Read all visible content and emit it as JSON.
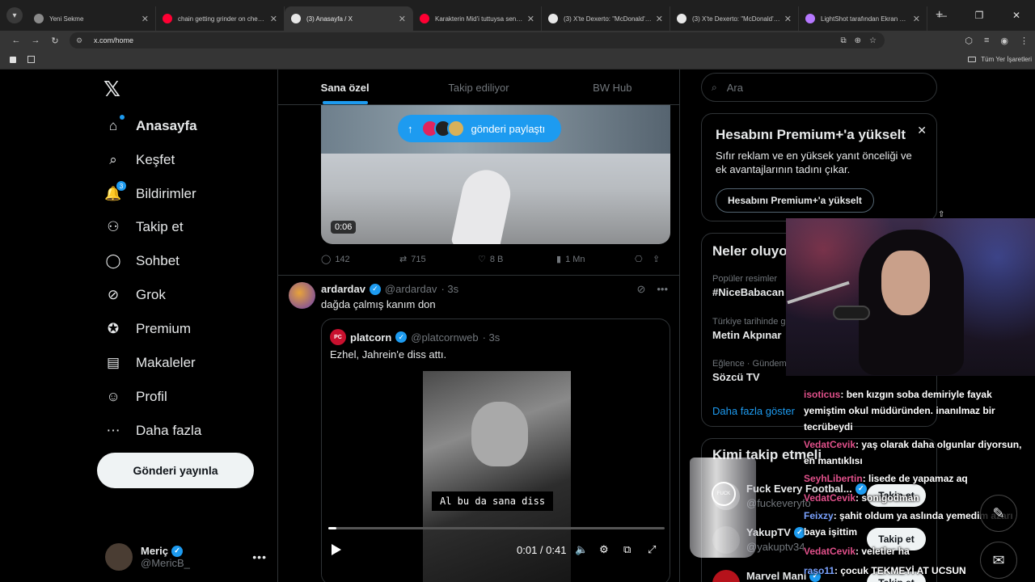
{
  "browser": {
    "tabs": [
      {
        "title": "Yeni Sekme",
        "favicon": "chrome-icon",
        "favicon_color": "#8a8a8a",
        "active": false
      },
      {
        "title": "chain getting grinder on cheese...",
        "favicon": "youtube-icon",
        "favicon_color": "#ff0033",
        "active": false
      },
      {
        "title": "(3) Anasayfa / X",
        "favicon": "x-icon",
        "favicon_color": "#e8e8e8",
        "active": true
      },
      {
        "title": "Karakterin Mid'i tuttuysa sen de...",
        "favicon": "youtube-icon",
        "favicon_color": "#ff0033",
        "active": false
      },
      {
        "title": "(3) X'te Dexerto: \"McDonald's h...",
        "favicon": "x-icon",
        "favicon_color": "#e8e8e8",
        "active": false
      },
      {
        "title": "(3) X'te Dexerto: \"McDonald's h...",
        "favicon": "x-icon",
        "favicon_color": "#e8e8e8",
        "active": false
      },
      {
        "title": "LightShot tarafından Ekran Görü...",
        "favicon": "feather-icon",
        "favicon_color": "#b678ff",
        "active": false
      }
    ],
    "url": "x.com/home",
    "bookmarks_all": "Tüm Yer İşaretleri"
  },
  "nav": {
    "items": [
      {
        "label": "Anasayfa",
        "icon": "home-icon",
        "bold": true
      },
      {
        "label": "Keşfet",
        "icon": "search-icon"
      },
      {
        "label": "Bildirimler",
        "icon": "bell-icon",
        "badge": "3"
      },
      {
        "label": "Takip et",
        "icon": "add-user-icon"
      },
      {
        "label": "Sohbet",
        "icon": "chat-icon"
      },
      {
        "label": "Grok",
        "icon": "grok-icon"
      },
      {
        "label": "Premium",
        "icon": "premium-icon"
      },
      {
        "label": "Makaleler",
        "icon": "articles-icon"
      },
      {
        "label": "Profil",
        "icon": "profile-icon"
      },
      {
        "label": "Daha fazla",
        "icon": "more-icon"
      }
    ],
    "post_button": "Gönderi yayınla",
    "account": {
      "name": "Meriç",
      "handle": "@MericB_"
    }
  },
  "timeline": {
    "tabs": [
      "Sana özel",
      "Takip ediliyor",
      "BW Hub"
    ],
    "share_pill": "gönderi paylaştı",
    "tweet1": {
      "video_time": "0:06",
      "replies": "142",
      "retweets": "715",
      "likes": "8 B",
      "views": "1 Mn"
    },
    "tweet2": {
      "name": "ardardav",
      "handle": "@ardardav",
      "time": "· 3s",
      "text": "dağda çalmış kanım don",
      "quote": {
        "avatar_label": "PC",
        "name": "platcorn",
        "handle": "@platcornweb",
        "time": "· 3s",
        "text": "Ezhel, Jahrein'e diss attı.",
        "subtitle": "Al bu da sana diss",
        "duration": "0:01 / 0:41",
        "progress": 0.024
      }
    }
  },
  "sidebar": {
    "search_placeholder": "Ara",
    "premium": {
      "title": "Hesabını Premium+'a yükselt",
      "text": "Sıfır reklam ve en yüksek yanıt önceliği ve ek avantajlarının tadını çıkar.",
      "button": "Hesabını Premium+'a yükselt"
    },
    "trends": {
      "title": "Neler oluyo",
      "items": [
        {
          "category": "Popüler resimler",
          "name": "#NiceBabacan"
        },
        {
          "category": "Türkiye tarihinde g",
          "name": "Metin Akpınar"
        },
        {
          "category": "Eğlence · Gündem",
          "name": "Sözcü TV"
        }
      ],
      "more": "Daha fazla göster"
    },
    "follow": {
      "title": "Kimi takip etmeli",
      "items": [
        {
          "name": "Fuck Every Footbal...",
          "handle": "@fuckeveryfo",
          "button": "Takip et"
        },
        {
          "name": "YakupTV",
          "handle": "@yakuptv34",
          "button": "Takip et"
        },
        {
          "name": "Marvel Mani",
          "handle": "",
          "button": "Takip et"
        }
      ]
    }
  },
  "overlay": {
    "glass_logo": "FUCK",
    "chat": [
      {
        "user": "isoticus",
        "text": ": ben kızgın soba demiriyle fayak yemiştim okul müdüründen. inanılmaz bir tecrübeydi"
      },
      {
        "user": "VedatCevik",
        "text": ": yaş olarak daha olgunlar diyorsun, en mantıklısı"
      },
      {
        "user": "SeyhLibertin",
        "text": ": lisede de yapamaz aq"
      },
      {
        "user": "VedatCevik",
        "text": ": sonigodman"
      },
      {
        "user": "Feixzy",
        "text": ": şahit oldum ya aslında yemedim azarı baya işittim",
        "alt": true
      },
      {
        "user": "VedatCevik",
        "text": ": veletler ha"
      },
      {
        "user": "raso11",
        "text": ": çocuk TEKMEYİ AT UCSUN",
        "alt": true
      }
    ]
  }
}
